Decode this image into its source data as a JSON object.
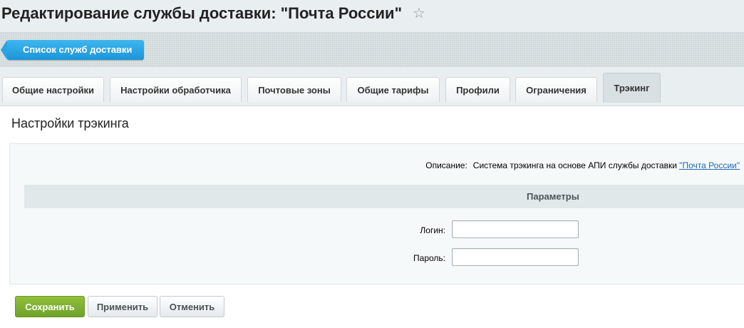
{
  "header": {
    "title": "Редактирование службы доставки: \"Почта России\"",
    "favorite_icon": "star-icon"
  },
  "toolbar": {
    "back_label": "Список служб доставки"
  },
  "tabs": [
    {
      "label": "Общие настройки",
      "active": false
    },
    {
      "label": "Настройки обработчика",
      "active": false
    },
    {
      "label": "Почтовые зоны",
      "active": false
    },
    {
      "label": "Общие тарифы",
      "active": false
    },
    {
      "label": "Профили",
      "active": false
    },
    {
      "label": "Ограничения",
      "active": false
    },
    {
      "label": "Трэкинг",
      "active": true
    }
  ],
  "panel": {
    "section_title": "Настройки трэкинга",
    "description_label": "Описание:",
    "description_text": "Система трэкинга на основе АПИ службы доставки ",
    "description_link": "\"Почта России\"",
    "params_title": "Параметры",
    "fields": [
      {
        "label": "Логин:",
        "value": "",
        "placeholder": ""
      },
      {
        "label": "Пароль:",
        "value": "",
        "placeholder": ""
      }
    ]
  },
  "buttons": {
    "save": "Сохранить",
    "apply": "Применить",
    "cancel": "Отменить"
  },
  "colors": {
    "accent_blue": "#1c95d8",
    "save_green": "#7bb02f",
    "link": "#2067b0"
  }
}
